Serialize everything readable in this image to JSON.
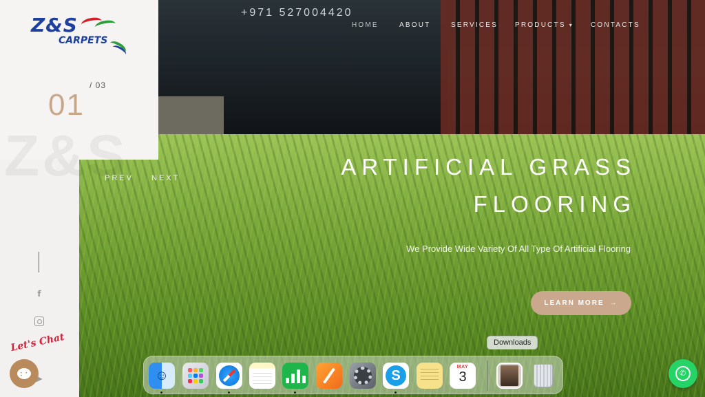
{
  "brand": {
    "logo_main": "Z&S",
    "logo_sub": "CARPETS",
    "watermark": "Z&S",
    "colors": {
      "accent": "#c9a88d",
      "logo_blue": "#1d3f9e",
      "logo_red": "#d4202a",
      "logo_green": "#2e9d3b"
    }
  },
  "header": {
    "phone": "+971 527004420",
    "nav": [
      "HOME",
      "ABOUT",
      "SERVICES",
      "PRODUCTS",
      "CONTACTS"
    ],
    "products_caret": "▾"
  },
  "slider": {
    "current": "01",
    "total": "/ 03",
    "prev": "PREV",
    "next": "NEXT",
    "headline_line1": "ARTIFICIAL GRASS",
    "headline_line2": "FLOORING",
    "subtitle": "We Provide Wide Variety Of All Type Of Artificial Flooring",
    "cta": "LEARN MORE",
    "cta_arrow": "→"
  },
  "social": {
    "facebook": "f",
    "instagram": "",
    "youtube": "▶"
  },
  "chat": {
    "label": "Let's Chat",
    "dots": "• • •"
  },
  "whatsapp": {
    "glyph": "✆"
  },
  "dock": {
    "tooltip": "Downloads",
    "apps": [
      "finder-icon",
      "launchpad-icon",
      "safari-icon",
      "notes-icon",
      "numbers-icon",
      "pages-icon",
      "system-settings-icon",
      "skype-icon",
      "stickies-icon",
      "calendar-icon",
      "downloads-icon",
      "trash-icon"
    ],
    "calendar_month": "MAY",
    "calendar_day": "3",
    "skype_letter": "S",
    "finder_face": "☺"
  }
}
